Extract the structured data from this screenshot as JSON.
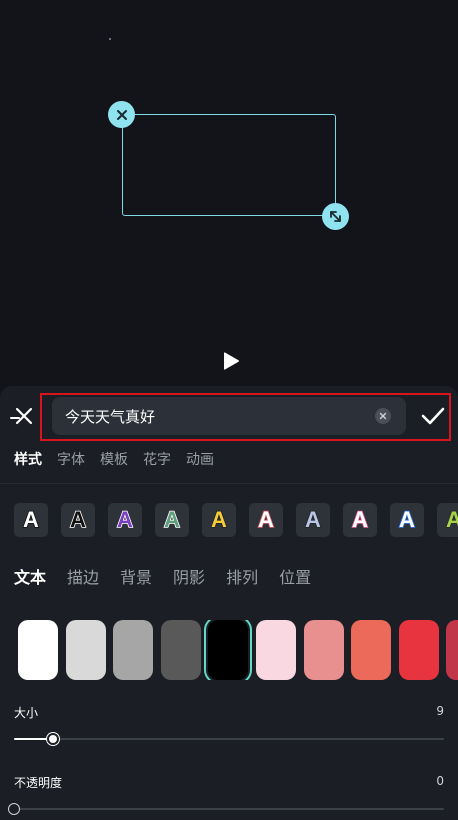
{
  "editor": {
    "text_value": "今天天气真好",
    "tabs": [
      {
        "label": "样式"
      },
      {
        "label": "字体"
      },
      {
        "label": "模板"
      },
      {
        "label": "花字"
      },
      {
        "label": "动画"
      }
    ],
    "subtabs": [
      {
        "label": "文本"
      },
      {
        "label": "描边"
      },
      {
        "label": "背景"
      },
      {
        "label": "阴影"
      },
      {
        "label": "排列"
      },
      {
        "label": "位置"
      }
    ],
    "presets": [
      {
        "glyph": "A",
        "fill": "#ffffff",
        "stroke": "#111111"
      },
      {
        "glyph": "A",
        "fill": "#111111",
        "stroke": "#ffffff"
      },
      {
        "glyph": "A",
        "fill": "#7a3fbf",
        "stroke": "#ffffff"
      },
      {
        "glyph": "A",
        "fill": "#5e9e7a",
        "stroke": "#ffffff"
      },
      {
        "glyph": "A",
        "fill": "#f3cc3a",
        "stroke": "#222222"
      },
      {
        "glyph": "A",
        "fill": "#ffffff",
        "stroke": "#e05a6a"
      },
      {
        "glyph": "A",
        "fill": "#b8c4e8",
        "stroke": "#222222"
      },
      {
        "glyph": "A",
        "fill": "#ffffff",
        "stroke": "#f06fa8"
      },
      {
        "glyph": "A",
        "fill": "#ffffff",
        "stroke": "#2f7cf0"
      },
      {
        "glyph": "A",
        "fill": "#a6d34a",
        "stroke": "#2a2a2a"
      }
    ],
    "colors": [
      "#ffffff",
      "#d9d9d9",
      "#a6a6a6",
      "#595959",
      "#000000",
      "#f9d8e2",
      "#e89090",
      "#ec6a5a",
      "#e8343e",
      "#c2364a"
    ],
    "selected_color_index": 4,
    "size": {
      "label": "大小",
      "value": "9",
      "fraction": 0.09
    },
    "opacity": {
      "label": "不透明度",
      "value": "0",
      "fraction": 0.0
    },
    "accent_color": "#63d9c4",
    "frame_color": "#7fd9e6"
  }
}
